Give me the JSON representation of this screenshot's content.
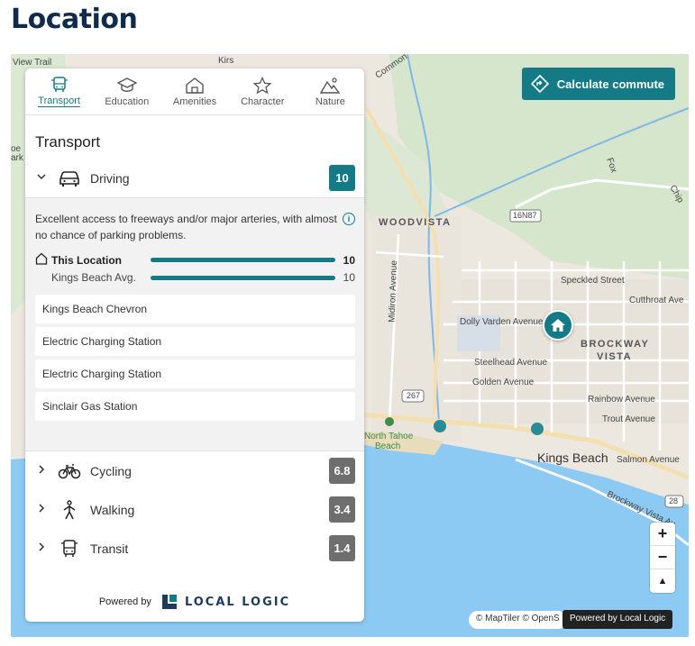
{
  "page": {
    "title": "Location"
  },
  "map": {
    "commute_button": "Calculate commute",
    "labels": {
      "view_trail": "View Trail",
      "common": "Common",
      "woodvista": "WOODVISTA",
      "road_16n87": "16N87",
      "midiron": "Midiron Avenue",
      "speckled": "Speckled Street",
      "cutthroat": "Cutthroat Ave",
      "dolly": "Dolly Varden Avenue",
      "brockway": "BROCKWAY",
      "vista": "VISTA",
      "steelhead": "Steelhead Avenue",
      "golden": "Golden Avenue",
      "rainbow": "Rainbow Avenue",
      "trout": "Trout Avenue",
      "salmon": "Salmon Avenue",
      "kings_beach": "Kings Beach",
      "north_tahoe": "North Tahoe",
      "beach": "Beach",
      "brockway_vista": "Brockway Vista Av",
      "route_267": "267",
      "route_28": "28",
      "fox": "Fox",
      "chip": "Chip",
      "oe": "oe",
      "ark": "ark",
      "kirs": "Kirs"
    },
    "attribution": "© MapTiler © OpenS",
    "powered_badge": "Powered by Local Logic",
    "zoom_in": "+",
    "zoom_out": "−",
    "compass": "▲"
  },
  "panel": {
    "tabs": [
      {
        "label": "Transport",
        "icon": "bus-icon",
        "active": true
      },
      {
        "label": "Education",
        "icon": "graduation-cap-icon",
        "active": false
      },
      {
        "label": "Amenities",
        "icon": "house-icon",
        "active": false
      },
      {
        "label": "Character",
        "icon": "star-icon",
        "active": false
      },
      {
        "label": "Nature",
        "icon": "mountain-icon",
        "active": false
      }
    ],
    "section_title": "Transport",
    "driving": {
      "label": "Driving",
      "score": "10",
      "description": "Excellent access to freeways and/or major arteries, with almost no chance of parking problems.",
      "this_location_label": "This Location",
      "this_location_value": "10",
      "avg_label": "Kings Beach Avg.",
      "avg_value": "10",
      "this_location_level": 1.0,
      "avg_level": 1.0,
      "pois": [
        "Kings Beach Chevron",
        "Electric Charging Station",
        "Electric Charging Station",
        "Sinclair Gas Station"
      ]
    },
    "cycling": {
      "label": "Cycling",
      "score": "6.8"
    },
    "walking": {
      "label": "Walking",
      "score": "3.4"
    },
    "transit": {
      "label": "Transit",
      "score": "1.4"
    },
    "powered_by": "Powered by",
    "logo_text": "LOCAL LOGIC"
  },
  "colors": {
    "accent": "#147a86",
    "grey_score": "#6e6e6e",
    "title": "#0f2a4a",
    "water": "#8ccaf3"
  }
}
